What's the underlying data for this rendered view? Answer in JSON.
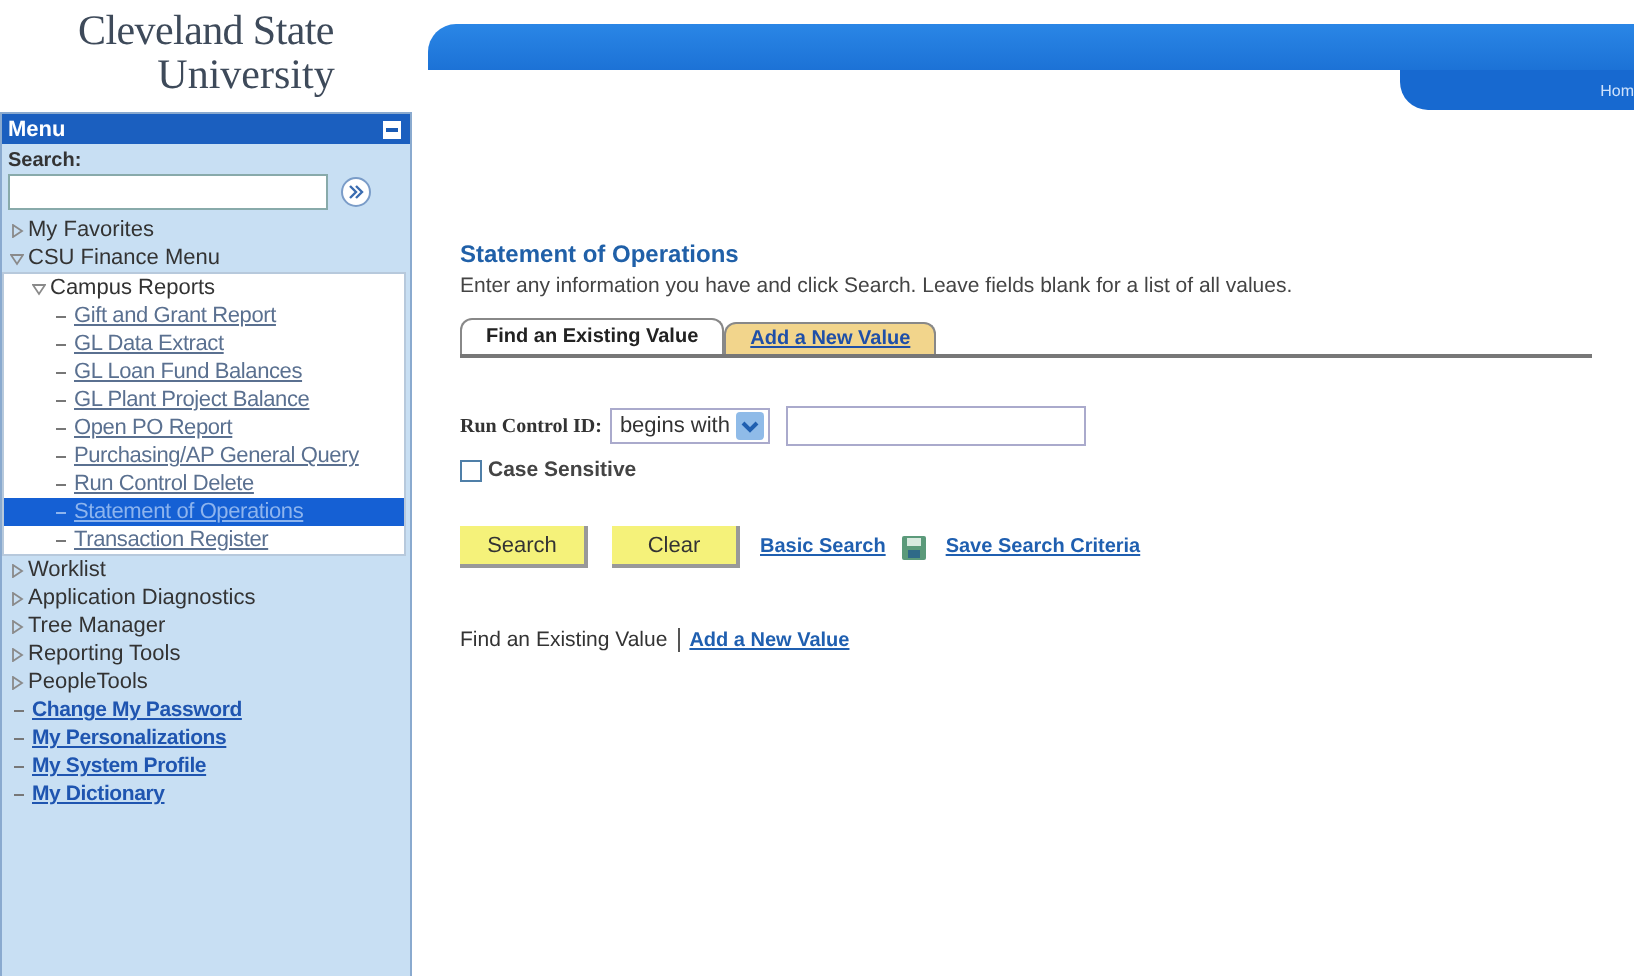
{
  "logo": {
    "line1": "Cleveland State",
    "line2": "University"
  },
  "banner": {
    "link": "Hom"
  },
  "menu": {
    "title": "Menu",
    "search_label": "Search:",
    "items": [
      {
        "label": "My Favorites",
        "kind": "folder",
        "expanded": false
      },
      {
        "label": "CSU Finance Menu",
        "kind": "folder",
        "expanded": true,
        "children": [
          {
            "label": "Campus Reports",
            "kind": "folder",
            "expanded": true,
            "children": [
              {
                "label": "Gift and Grant Report",
                "kind": "link",
                "selected": false
              },
              {
                "label": "GL Data Extract",
                "kind": "link",
                "selected": false
              },
              {
                "label": "GL Loan Fund Balances",
                "kind": "link",
                "selected": false
              },
              {
                "label": "GL Plant Project Balance",
                "kind": "link",
                "selected": false
              },
              {
                "label": "Open PO Report",
                "kind": "link",
                "selected": false
              },
              {
                "label": "Purchasing/AP General Query",
                "kind": "link",
                "selected": false
              },
              {
                "label": "Run Control Delete",
                "kind": "link",
                "selected": false
              },
              {
                "label": "Statement of Operations",
                "kind": "link",
                "selected": true
              },
              {
                "label": "Transaction Register",
                "kind": "link",
                "selected": false
              }
            ]
          }
        ]
      },
      {
        "label": "Worklist",
        "kind": "folder",
        "expanded": false
      },
      {
        "label": "Application Diagnostics",
        "kind": "folder",
        "expanded": false
      },
      {
        "label": "Tree Manager",
        "kind": "folder",
        "expanded": false
      },
      {
        "label": "Reporting Tools",
        "kind": "folder",
        "expanded": false
      },
      {
        "label": "PeopleTools",
        "kind": "folder",
        "expanded": false
      },
      {
        "label": "Change My Password",
        "kind": "toplink",
        "selected": false
      },
      {
        "label": "My Personalizations",
        "kind": "toplink",
        "selected": false
      },
      {
        "label": "My System Profile",
        "kind": "toplink",
        "selected": false
      },
      {
        "label": "My Dictionary",
        "kind": "toplink",
        "selected": false
      }
    ]
  },
  "page": {
    "title": "Statement of Operations",
    "instructions": "Enter any information you have and click Search. Leave fields blank for a list of all values.",
    "tabs": [
      {
        "label": "Find an Existing Value",
        "selected": true
      },
      {
        "label": "Add a New Value",
        "selected": false
      }
    ],
    "run_control": {
      "label": "Run Control ID:",
      "operator": "begins with"
    },
    "case_sensitive": {
      "label": "Case Sensitive",
      "checked": false
    },
    "buttons": [
      "Search",
      "Clear"
    ],
    "links": [
      "Basic Search",
      "Save Search Criteria"
    ],
    "footer_links": [
      {
        "label": "Find an Existing Value",
        "selected": true
      },
      {
        "label": "Add a New Value",
        "selected": false
      }
    ]
  }
}
